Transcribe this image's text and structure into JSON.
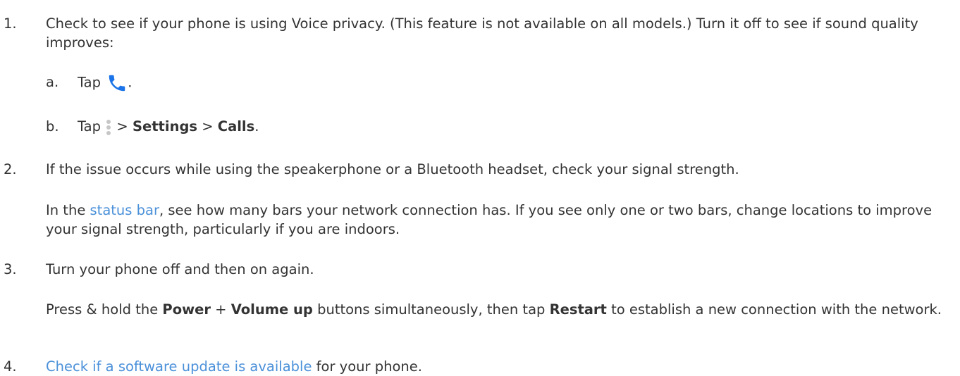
{
  "steps": [
    {
      "num": "1.",
      "text": "Check to see if your phone is using Voice privacy. (This feature is not available on all models.) Turn it off to see if sound quality improves:",
      "substeps": [
        {
          "num": "a.",
          "tap": "Tap",
          "icon": "phone-icon",
          "end": "."
        },
        {
          "num": "b.",
          "tap": "Tap",
          "icon": "more-vert-icon",
          "sep1": ">",
          "bold1": "Settings",
          "sep2": ">",
          "bold2": "Calls",
          "end": "."
        }
      ]
    },
    {
      "num": "2.",
      "text": "If the issue occurs while using the speakerphone or a Bluetooth headset, check your signal strength.",
      "para_pre": "In the",
      "para_link": "status bar",
      "para_post": ", see how many bars your network connection has. If you see only one or two bars, change locations to improve your signal strength, particularly if you are indoors."
    },
    {
      "num": "3.",
      "text": "Turn your phone off and then on again.",
      "p1": "Press & hold the",
      "b1": "Power",
      "p2": "+",
      "b2": "Volume up",
      "p3": "buttons simultaneously, then tap",
      "b3": "Restart",
      "p4": "to establish a new connection with the network."
    },
    {
      "num": "4.",
      "link": "Check if a software update is available",
      "text": "for your phone."
    }
  ],
  "colors": {
    "link": "#4a90d9",
    "phone_icon": "#1a73e8",
    "dots": "#c6c6c6"
  }
}
